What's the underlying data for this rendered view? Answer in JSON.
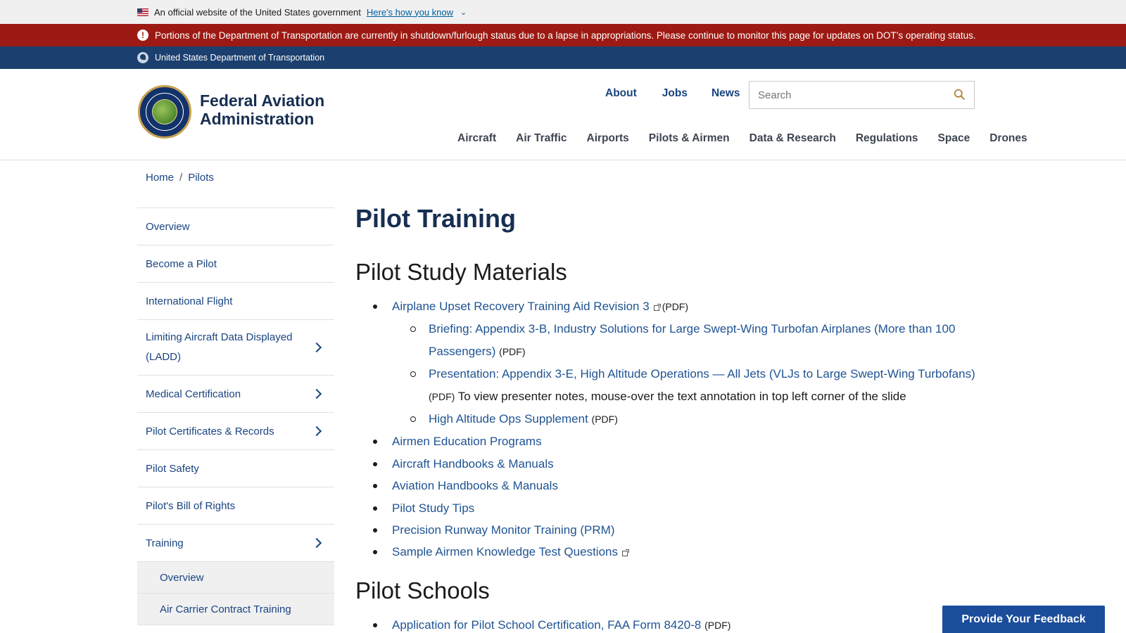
{
  "gov_banner": {
    "text": "An official website of the United States government",
    "how_link": "Here's how you know"
  },
  "alert": {
    "text": "Portions of the Department of Transportation are currently in shutdown/furlough status due to a lapse in appropriations. Please continue to monitor this page for updates on DOT’s operating status."
  },
  "dot_bar": {
    "text": "United States Department of Transportation"
  },
  "brand": {
    "line1": "Federal Aviation",
    "line2": "Administration"
  },
  "utility_nav": [
    "About",
    "Jobs",
    "News"
  ],
  "search": {
    "placeholder": "Search"
  },
  "main_nav": [
    "Aircraft",
    "Air Traffic",
    "Airports",
    "Pilots & Airmen",
    "Data & Research",
    "Regulations",
    "Space",
    "Drones"
  ],
  "breadcrumb": {
    "home": "Home",
    "sep": "/",
    "current": "Pilots"
  },
  "sidebar": {
    "items": [
      {
        "label": "Overview"
      },
      {
        "label": "Become a Pilot"
      },
      {
        "label": "International Flight"
      },
      {
        "label": "Limiting Aircraft Data Displayed (LADD)"
      },
      {
        "label": "Medical Certification"
      },
      {
        "label": "Pilot Certificates & Records"
      },
      {
        "label": "Pilot Safety"
      },
      {
        "label": "Pilot's Bill of Rights"
      },
      {
        "label": "Training"
      }
    ],
    "sub_items": [
      {
        "label": "Overview"
      },
      {
        "label": "Air Carrier Contract Training"
      }
    ]
  },
  "page": {
    "title": "Pilot Training",
    "section1": {
      "heading": "Pilot Study Materials",
      "item1": "Airplane Upset Recovery Training Aid Revision 3",
      "pdf": "(PDF)",
      "sub1": "Briefing: Appendix 3-B, Industry Solutions for Large Swept-Wing Turbofan Airplanes (More than 100 Passengers)",
      "sub2": "Presentation: Appendix 3-E, High Altitude Operations — All Jets (VLJs to Large Swept-Wing Turbofans)",
      "sub2_note": "To view presenter notes, mouse-over the text annotation in top left corner of the slide",
      "sub3": "High Altitude Ops Supplement",
      "item2": "Airmen Education Programs",
      "item3": "Aircraft Handbooks & Manuals",
      "item4": "Aviation Handbooks & Manuals",
      "item5": "Pilot Study Tips",
      "item6": "Precision Runway Monitor Training (PRM)",
      "item7": "Sample Airmen Knowledge Test Questions"
    },
    "section2": {
      "heading": "Pilot Schools",
      "item1": "Application for Pilot School Certification, FAA Form 8420-8"
    }
  },
  "feedback": {
    "label": "Provide Your Feedback"
  }
}
